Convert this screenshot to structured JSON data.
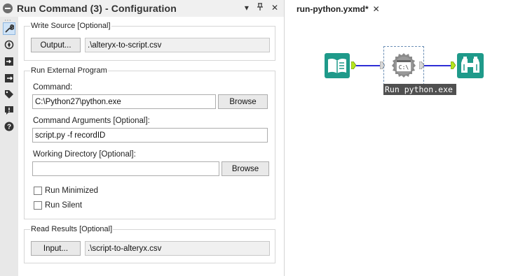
{
  "config_panel": {
    "title": "Run Command (3) - Configuration",
    "title_buttons": {
      "dropdown": "▾",
      "pin": "📌",
      "close": "✕"
    },
    "toolbar": {
      "grip": "⋯",
      "buttons": [
        {
          "icon": "wrench-icon",
          "active": true
        },
        {
          "icon": "compass-icon"
        },
        {
          "icon": "input-arrow-icon"
        },
        {
          "icon": "output-arrow-icon"
        },
        {
          "icon": "tag-icon"
        },
        {
          "icon": "comment-icon"
        },
        {
          "icon": "help-icon"
        }
      ]
    },
    "write_source": {
      "title": "Write Source [Optional]",
      "button_label": "Output...",
      "path": ".\\alteryx-to-script.csv"
    },
    "run_external": {
      "title": "Run External Program",
      "command_label": "Command:",
      "command_value": "C:\\Python27\\python.exe",
      "command_browse": "Browse",
      "args_label": "Command Arguments [Optional]:",
      "args_value": "script.py -f recordID",
      "workdir_label": "Working Directory [Optional]:",
      "workdir_value": "",
      "workdir_browse": "Browse",
      "run_minimized_label": "Run Minimized",
      "run_minimized_checked": false,
      "run_silent_label": "Run Silent",
      "run_silent_checked": false
    },
    "read_results": {
      "title": "Read Results [Optional]",
      "button_label": "Input...",
      "path": ".\\script-to-alteryx.csv"
    }
  },
  "canvas": {
    "tab_title": "run-python.yxmd*",
    "tab_close": "✕",
    "tools": [
      {
        "icon": "book-input-icon",
        "color": "#1f9a8a"
      },
      {
        "icon": "run-command-icon",
        "color": "#8a8a8a"
      },
      {
        "icon": "binoculars-browse-icon",
        "color": "#1f9a8a"
      }
    ],
    "selected_tool_caption": "Run python.exe",
    "connection_color": "#2e2ed6"
  }
}
